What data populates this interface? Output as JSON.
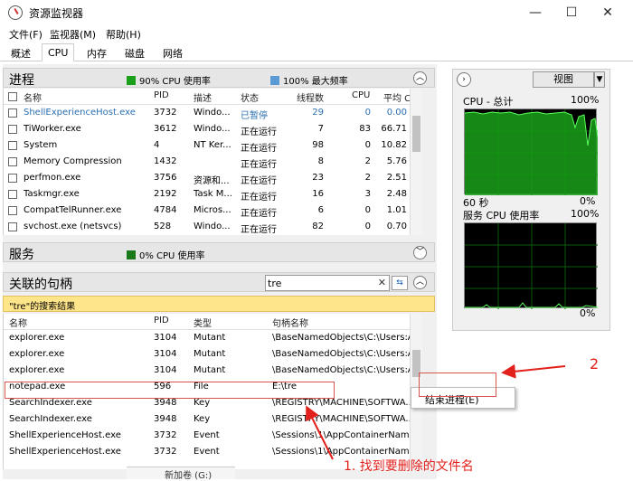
{
  "window": {
    "title": "资源监视器"
  },
  "menu": [
    "文件(F)",
    "监视器(M)",
    "帮助(H)"
  ],
  "tabs": [
    "概述",
    "CPU",
    "内存",
    "磁盘",
    "网络"
  ],
  "processes": {
    "title": "进程",
    "legend_cpu": "90% CPU 使用率",
    "legend_freq": "100% 最大频率",
    "columns": [
      "名称",
      "PID",
      "描述",
      "状态",
      "线程数",
      "CPU",
      "平均 C..."
    ],
    "rows": [
      {
        "name": "ShellExperienceHost.exe",
        "pid": "3732",
        "desc": "Windo...",
        "status": "已暂停",
        "threads": "29",
        "cpu": "0",
        "avg": "0.00"
      },
      {
        "name": "TiWorker.exe",
        "pid": "3612",
        "desc": "Windo...",
        "status": "正在运行",
        "threads": "7",
        "cpu": "83",
        "avg": "66.71"
      },
      {
        "name": "System",
        "pid": "4",
        "desc": "NT Ker...",
        "status": "正在运行",
        "threads": "98",
        "cpu": "0",
        "avg": "10.82"
      },
      {
        "name": "Memory Compression",
        "pid": "1432",
        "desc": "",
        "status": "正在运行",
        "threads": "8",
        "cpu": "2",
        "avg": "5.76"
      },
      {
        "name": "perfmon.exe",
        "pid": "3756",
        "desc": "资源和...",
        "status": "正在运行",
        "threads": "23",
        "cpu": "2",
        "avg": "2.51"
      },
      {
        "name": "Taskmgr.exe",
        "pid": "2192",
        "desc": "Task M...",
        "status": "正在运行",
        "threads": "16",
        "cpu": "3",
        "avg": "2.48"
      },
      {
        "name": "CompatTelRunner.exe",
        "pid": "4784",
        "desc": "Micros...",
        "status": "正在运行",
        "threads": "6",
        "cpu": "0",
        "avg": "1.01"
      },
      {
        "name": "svchost.exe (netsvcs)",
        "pid": "528",
        "desc": "Windo...",
        "status": "正在运行",
        "threads": "82",
        "cpu": "0",
        "avg": "0.70"
      }
    ]
  },
  "services": {
    "title": "服务",
    "legend_cpu": "0% CPU 使用率"
  },
  "handles": {
    "title": "关联的句柄",
    "search_value": "tre",
    "result_label": "\"tre\"的搜索结果",
    "columns": [
      "名称",
      "PID",
      "类型",
      "句柄名称"
    ],
    "rows": [
      {
        "name": "explorer.exe",
        "pid": "3104",
        "type": "Mutant",
        "handle": "\\BaseNamedObjects\\C:\\Users:A..."
      },
      {
        "name": "explorer.exe",
        "pid": "3104",
        "type": "Mutant",
        "handle": "\\BaseNamedObjects\\C:\\Users:A..."
      },
      {
        "name": "explorer.exe",
        "pid": "3104",
        "type": "Mutant",
        "handle": "\\BaseNamedObjects\\C:\\Users:A..."
      },
      {
        "name": "notepad.exe",
        "pid": "596",
        "type": "File",
        "handle": "E:\\tre"
      },
      {
        "name": "SearchIndexer.exe",
        "pid": "3948",
        "type": "Key",
        "handle": "\\REGISTRY\\MACHINE\\SOFTWA..."
      },
      {
        "name": "SearchIndexer.exe",
        "pid": "3948",
        "type": "Key",
        "handle": "\\REGISTRY\\MACHINE\\SOFTWA..."
      },
      {
        "name": "ShellExperienceHost.exe",
        "pid": "3732",
        "type": "Event",
        "handle": "\\Sessions\\1\\AppContainerName..."
      },
      {
        "name": "ShellExperienceHost.exe",
        "pid": "3732",
        "type": "Event",
        "handle": "\\Sessions\\1\\AppContainerName..."
      }
    ]
  },
  "right_panel": {
    "view_label": "视图",
    "cpu_total_label": "CPU - 总计",
    "cpu_total_max": "100%",
    "time_label": "60 秒",
    "cpu_total_min": "0%",
    "service_cpu_label": "服务 CPU 使用率",
    "service_cpu_max": "100%",
    "service_cpu_min": "0%"
  },
  "context_menu": {
    "end_process": "结束进程(E)"
  },
  "annotations": {
    "step1": "1. 找到要删除的文件名",
    "step2": "2"
  },
  "bottom_fragment": "新加卷 (G:)",
  "colors": {
    "cpu_green": "#1aa01a",
    "freq_blue": "#5b9bd5",
    "annotation_red": "#e2211c",
    "search_result_yellow": "#ffe58a"
  }
}
